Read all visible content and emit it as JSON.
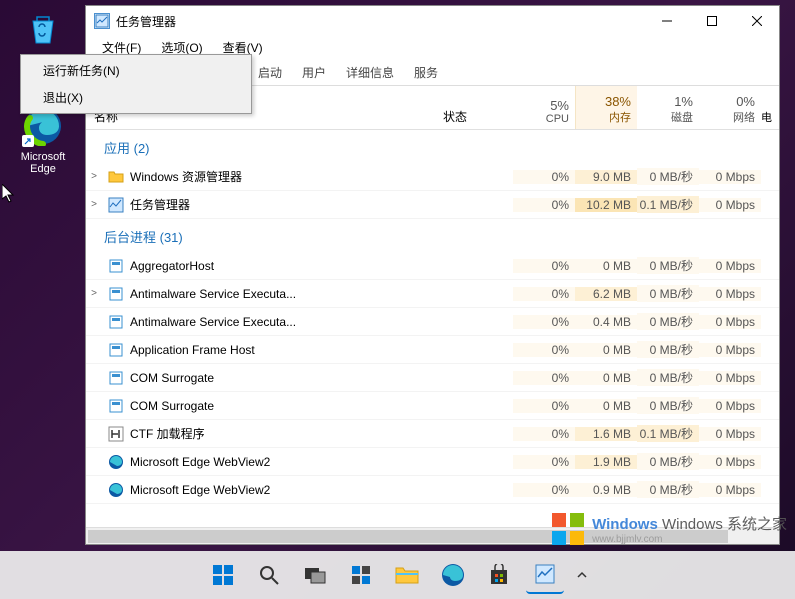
{
  "desktop": {
    "recycle_label": "回收站",
    "edge_label": "Microsoft Edge"
  },
  "window": {
    "title": "任务管理器",
    "menu": {
      "file": "文件(F)",
      "options": "选项(O)",
      "view": "查看(V)"
    },
    "dropdown": {
      "run": "运行新任务(N)",
      "exit": "退出(X)"
    },
    "tabs": {
      "startup": "启动",
      "users": "用户",
      "details": "详细信息",
      "services": "服务"
    },
    "columns": {
      "name": "名称",
      "status": "状态",
      "cpu_pct": "5%",
      "cpu_lbl": "CPU",
      "mem_pct": "38%",
      "mem_lbl": "内存",
      "disk_pct": "1%",
      "disk_lbl": "磁盘",
      "net_pct": "0%",
      "net_lbl": "网络",
      "power": "电"
    },
    "section_apps": "应用 (2)",
    "section_bg": "后台进程 (31)",
    "rows": [
      {
        "exp": ">",
        "icon": "folder",
        "name": "Windows 资源管理器",
        "cpu": "0%",
        "mem": "9.0 MB",
        "disk": "0 MB/秒",
        "net": "0 Mbps",
        "h": [
          1,
          2,
          1,
          1
        ]
      },
      {
        "exp": ">",
        "icon": "tm",
        "name": "任务管理器",
        "cpu": "0%",
        "mem": "10.2 MB",
        "disk": "0.1 MB/秒",
        "net": "0 Mbps",
        "h": [
          1,
          3,
          2,
          1
        ]
      },
      {
        "exp": "",
        "icon": "app",
        "name": "AggregatorHost",
        "cpu": "0%",
        "mem": "0 MB",
        "disk": "0 MB/秒",
        "net": "0 Mbps",
        "h": [
          1,
          1,
          1,
          1
        ]
      },
      {
        "exp": ">",
        "icon": "app",
        "name": "Antimalware Service Executa...",
        "cpu": "0%",
        "mem": "6.2 MB",
        "disk": "0 MB/秒",
        "net": "0 Mbps",
        "h": [
          1,
          2,
          1,
          1
        ]
      },
      {
        "exp": "",
        "icon": "app",
        "name": "Antimalware Service Executa...",
        "cpu": "0%",
        "mem": "0.4 MB",
        "disk": "0 MB/秒",
        "net": "0 Mbps",
        "h": [
          1,
          1,
          1,
          1
        ]
      },
      {
        "exp": "",
        "icon": "app",
        "name": "Application Frame Host",
        "cpu": "0%",
        "mem": "0 MB",
        "disk": "0 MB/秒",
        "net": "0 Mbps",
        "h": [
          1,
          1,
          1,
          1
        ]
      },
      {
        "exp": "",
        "icon": "app",
        "name": "COM Surrogate",
        "cpu": "0%",
        "mem": "0 MB",
        "disk": "0 MB/秒",
        "net": "0 Mbps",
        "h": [
          1,
          1,
          1,
          1
        ]
      },
      {
        "exp": "",
        "icon": "app",
        "name": "COM Surrogate",
        "cpu": "0%",
        "mem": "0 MB",
        "disk": "0 MB/秒",
        "net": "0 Mbps",
        "h": [
          1,
          1,
          1,
          1
        ]
      },
      {
        "exp": "",
        "icon": "ctf",
        "name": "CTF 加载程序",
        "cpu": "0%",
        "mem": "1.6 MB",
        "disk": "0.1 MB/秒",
        "net": "0 Mbps",
        "h": [
          1,
          2,
          2,
          1
        ]
      },
      {
        "exp": "",
        "icon": "edge",
        "name": "Microsoft Edge WebView2",
        "cpu": "0%",
        "mem": "1.9 MB",
        "disk": "0 MB/秒",
        "net": "0 Mbps",
        "h": [
          1,
          2,
          1,
          1
        ]
      },
      {
        "exp": "",
        "icon": "edge",
        "name": "Microsoft Edge WebView2",
        "cpu": "0%",
        "mem": "0.9 MB",
        "disk": "0 MB/秒",
        "net": "0 Mbps",
        "h": [
          1,
          1,
          1,
          1
        ]
      }
    ]
  },
  "watermark": {
    "t1": "Windows 系统之家",
    "t2": "www.bjjmlv.com"
  }
}
